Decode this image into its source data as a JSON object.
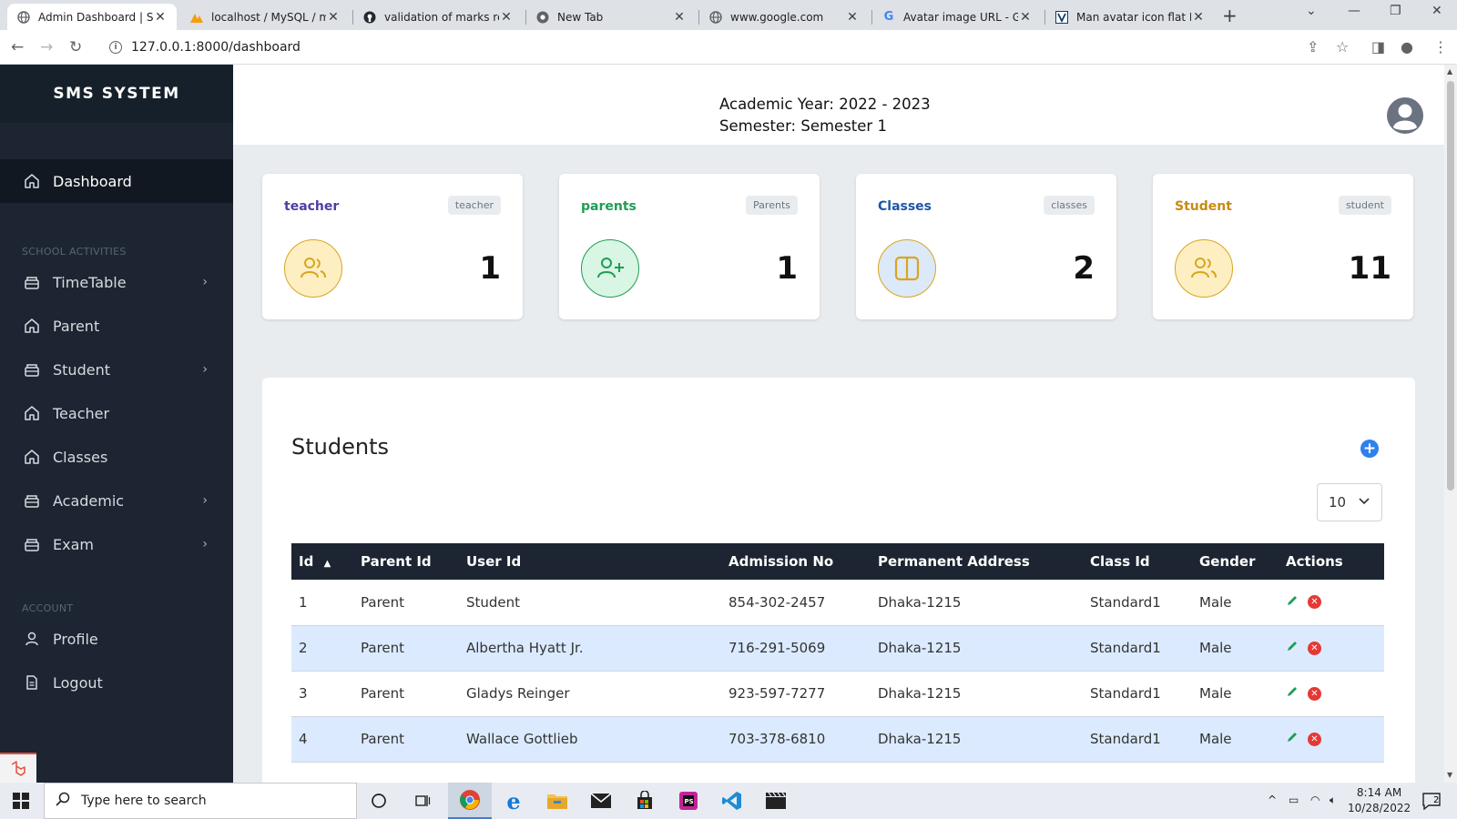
{
  "browser": {
    "tabs": [
      {
        "title": "Admin Dashboard | Sch",
        "icon": "globe-icon",
        "active": true
      },
      {
        "title": "localhost / MySQL / my",
        "icon": "phpmyadmin-icon",
        "active": false
      },
      {
        "title": "validation of marks rem",
        "icon": "github-icon",
        "active": false
      },
      {
        "title": "New Tab",
        "icon": "chrome-icon",
        "active": false
      },
      {
        "title": "www.google.com",
        "icon": "globe-icon",
        "active": false
      },
      {
        "title": "Avatar image URL - Goo",
        "icon": "google-icon",
        "active": false
      },
      {
        "title": "Man avatar icon flat Ro",
        "icon": "vector-site-icon",
        "active": false
      }
    ],
    "url": "127.0.0.1:8000/dashboard"
  },
  "sidebar": {
    "brand": "SMS SYSTEM",
    "dashboard_label": "Dashboard",
    "section_school": "SCHOOL ACTIVITIES",
    "school_items": [
      {
        "label": "TimeTable",
        "has_children": true
      },
      {
        "label": "Parent",
        "has_children": false
      },
      {
        "label": "Student",
        "has_children": true
      },
      {
        "label": "Teacher",
        "has_children": false
      },
      {
        "label": "Classes",
        "has_children": false
      },
      {
        "label": "Academic",
        "has_children": true
      },
      {
        "label": "Exam",
        "has_children": true
      }
    ],
    "section_account": "ACCOUNT",
    "account_items": [
      {
        "label": "Profile"
      },
      {
        "label": "Logout"
      }
    ]
  },
  "header": {
    "academic_year": "Academic Year: 2022 - 2023",
    "semester": "Semester: Semester 1"
  },
  "cards": [
    {
      "title": "teacher",
      "badge": "teacher",
      "value": "1",
      "color": "#4b3fa8",
      "icon_bg": "#fdefc2",
      "icon_color": "#d9a520",
      "icon": "users-icon"
    },
    {
      "title": "parents",
      "badge": "Parents",
      "value": "1",
      "color": "#1f9d55",
      "icon_bg": "#d9f5e4",
      "icon_color": "#1f9d55",
      "icon": "user-plus-icon"
    },
    {
      "title": "Classes",
      "badge": "classes",
      "value": "2",
      "color": "#1e55a8",
      "icon_bg": "#dbe9f8",
      "icon_color": "#d9a520",
      "icon": "columns-icon"
    },
    {
      "title": "Student",
      "badge": "student",
      "value": "11",
      "color": "#c98b11",
      "icon_bg": "#fdefc2",
      "icon_color": "#d9a520",
      "icon": "users-icon"
    }
  ],
  "students": {
    "title": "Students",
    "per_page": "10",
    "columns": [
      "Id",
      "Parent Id",
      "User Id",
      "Admission No",
      "Permanent Address",
      "Class Id",
      "Gender",
      "Actions"
    ],
    "rows": [
      [
        "1",
        "Parent",
        "Student",
        "854-302-2457",
        "Dhaka-1215",
        "Standard1",
        "Male"
      ],
      [
        "2",
        "Parent",
        "Albertha Hyatt Jr.",
        "716-291-5069",
        "Dhaka-1215",
        "Standard1",
        "Male"
      ],
      [
        "3",
        "Parent",
        "Gladys Reinger",
        "923-597-7277",
        "Dhaka-1215",
        "Standard1",
        "Male"
      ],
      [
        "4",
        "Parent",
        "Wallace Gottlieb",
        "703-378-6810",
        "Dhaka-1215",
        "Standard1",
        "Male"
      ]
    ]
  },
  "taskbar": {
    "search_placeholder": "Type here to search",
    "time": "8:14 AM",
    "date": "10/28/2022",
    "notifications": "2"
  }
}
